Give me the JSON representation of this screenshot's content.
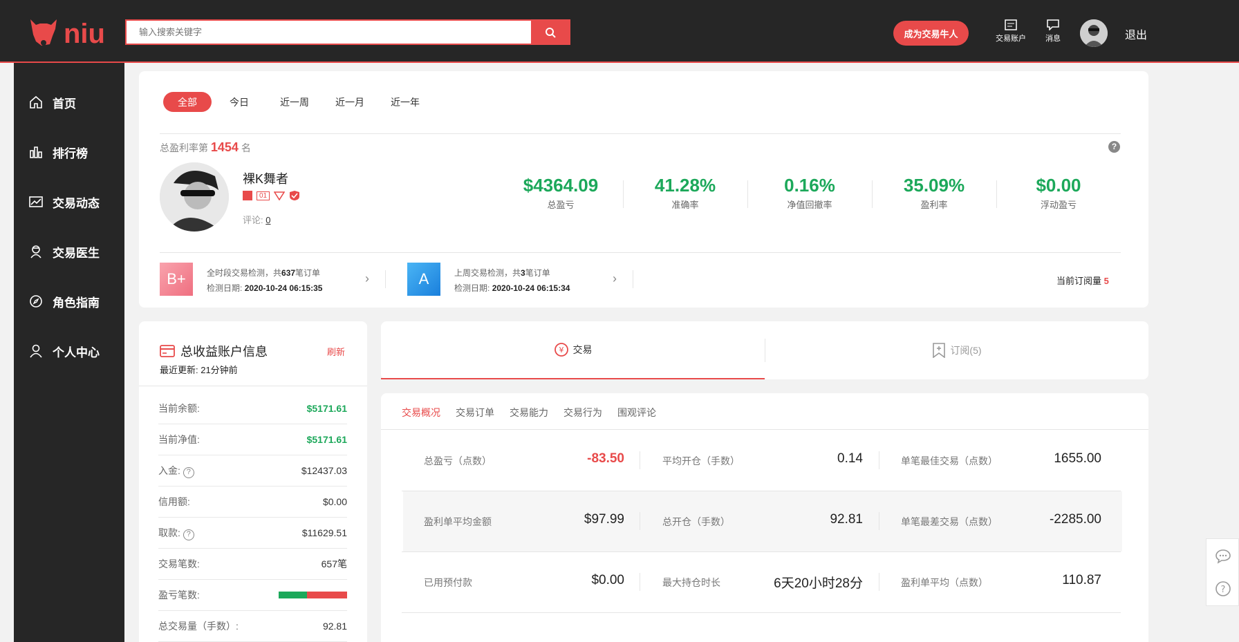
{
  "header": {
    "logo_text": "niu",
    "search_placeholder": "输入搜索关键字",
    "cta_label": "成为交易牛人",
    "trade_account_label": "交易账户",
    "messages_label": "消息",
    "logout_label": "退出"
  },
  "sidebar": {
    "items": [
      {
        "label": "首页",
        "icon": "home-icon"
      },
      {
        "label": "排行榜",
        "icon": "bar-chart-icon"
      },
      {
        "label": "交易动态",
        "icon": "trend-icon"
      },
      {
        "label": "交易医生",
        "icon": "doctor-icon"
      },
      {
        "label": "角色指南",
        "icon": "compass-icon"
      },
      {
        "label": "个人中心",
        "icon": "user-icon"
      }
    ]
  },
  "filters": {
    "items": [
      "全部",
      "今日",
      "近一周",
      "近一月",
      "近一年"
    ],
    "active": "全部"
  },
  "profile": {
    "rank_prefix": "总盈利率第",
    "rank_value": "1454",
    "rank_suffix": "名",
    "name": "裸K舞者",
    "badge_level": "01",
    "comments_label": "评论:",
    "comments_count": "0"
  },
  "stats": [
    {
      "value": "$4364.09",
      "label": "总盈亏"
    },
    {
      "value": "41.28%",
      "label": "准确率"
    },
    {
      "value": "0.16%",
      "label": "净值回撤率"
    },
    {
      "value": "35.09%",
      "label": "盈利率"
    },
    {
      "value": "$0.00",
      "label": "浮动盈亏"
    }
  ],
  "checks": [
    {
      "grade": "B+",
      "line1_prefix": "全时段交易检测，共",
      "line1_count": "637",
      "line1_suffix": "笔订单",
      "line2_label": "检测日期:",
      "line2_value": "2020-10-24 06:15:35",
      "color": "#f07c8a"
    },
    {
      "grade": "A",
      "line1_prefix": "上周交易检测，共",
      "line1_count": "3",
      "line1_suffix": "笔订单",
      "line2_label": "检测日期:",
      "line2_value": "2020-10-24 06:15:34",
      "color": "#2f9ee8"
    }
  ],
  "subscribers": {
    "label": "当前订阅量",
    "value": "5"
  },
  "account": {
    "title": "总收益账户信息",
    "refresh": "刷新",
    "updated_label": "最近更新: 21分钟前",
    "rows": [
      {
        "k": "当前余额:",
        "v": "$5171.61",
        "green": true
      },
      {
        "k": "当前净值:",
        "v": "$5171.61",
        "green": true
      },
      {
        "k": "入金:",
        "v": "$12437.03",
        "help": true
      },
      {
        "k": "信用额:",
        "v": "$0.00"
      },
      {
        "k": "取款:",
        "v": "$11629.51",
        "help": true
      },
      {
        "k": "交易笔数:",
        "v": "657笔"
      },
      {
        "k": "盈亏笔数:",
        "v": ""
      },
      {
        "k": "总交易量（手数）:",
        "v": "92.81"
      }
    ],
    "win_ratio": 0.41
  },
  "main_tabs": {
    "trade": "交易",
    "subscribe": "订阅(5)"
  },
  "sub_tabs": [
    "交易概况",
    "交易订单",
    "交易能力",
    "交易行为",
    "围观评论"
  ],
  "overview": [
    [
      {
        "k": "总盈亏（点数）",
        "v": "-83.50",
        "red": true
      },
      {
        "k": "平均开仓（手数）",
        "v": "0.14"
      },
      {
        "k": "单笔最佳交易（点数）",
        "v": "1655.00"
      }
    ],
    [
      {
        "k": "盈利单平均金额",
        "v": "$97.99"
      },
      {
        "k": "总开仓（手数）",
        "v": "92.81"
      },
      {
        "k": "单笔最差交易（点数）",
        "v": "-2285.00"
      }
    ],
    [
      {
        "k": "已用预付款",
        "v": "$0.00"
      },
      {
        "k": "最大持仓时长",
        "v": "6天20小时28分"
      },
      {
        "k": "盈利单平均（点数）",
        "v": "110.87"
      }
    ]
  ]
}
